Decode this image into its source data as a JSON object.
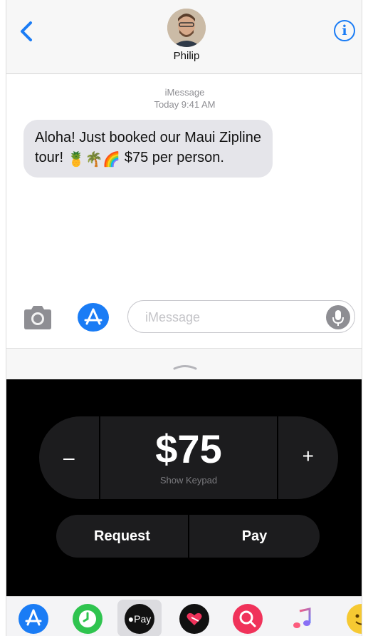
{
  "header": {
    "contact_name": "Philip",
    "info_label": "i"
  },
  "transcript": {
    "service": "iMessage",
    "timestamp": "Today 9:41 AM",
    "message_text_part1": "Aloha! Just booked our Maui Zipline tour! ",
    "emojis": [
      "🍍",
      "🌴",
      "🌈"
    ],
    "message_text_part2": " $75 per person."
  },
  "input_bar": {
    "placeholder": "iMessage"
  },
  "apple_pay": {
    "amount": "$75",
    "keypad_hint": "Show Keypad",
    "minus_label": "–",
    "plus_label": "+",
    "request_label": "Request",
    "pay_label": "Pay"
  },
  "app_drawer": {
    "apps": [
      "app-store-icon",
      "clock-icon",
      "apple-pay-icon",
      "digital-touch-icon",
      "image-search-icon",
      "music-icon",
      "emoji-stickers-icon"
    ],
    "pay_label": "Pay",
    "selected": "apple-pay-icon"
  },
  "colors": {
    "accent": "#1a7cf5",
    "bubble_gray": "#e5e5ea",
    "panel_black": "#000000"
  }
}
